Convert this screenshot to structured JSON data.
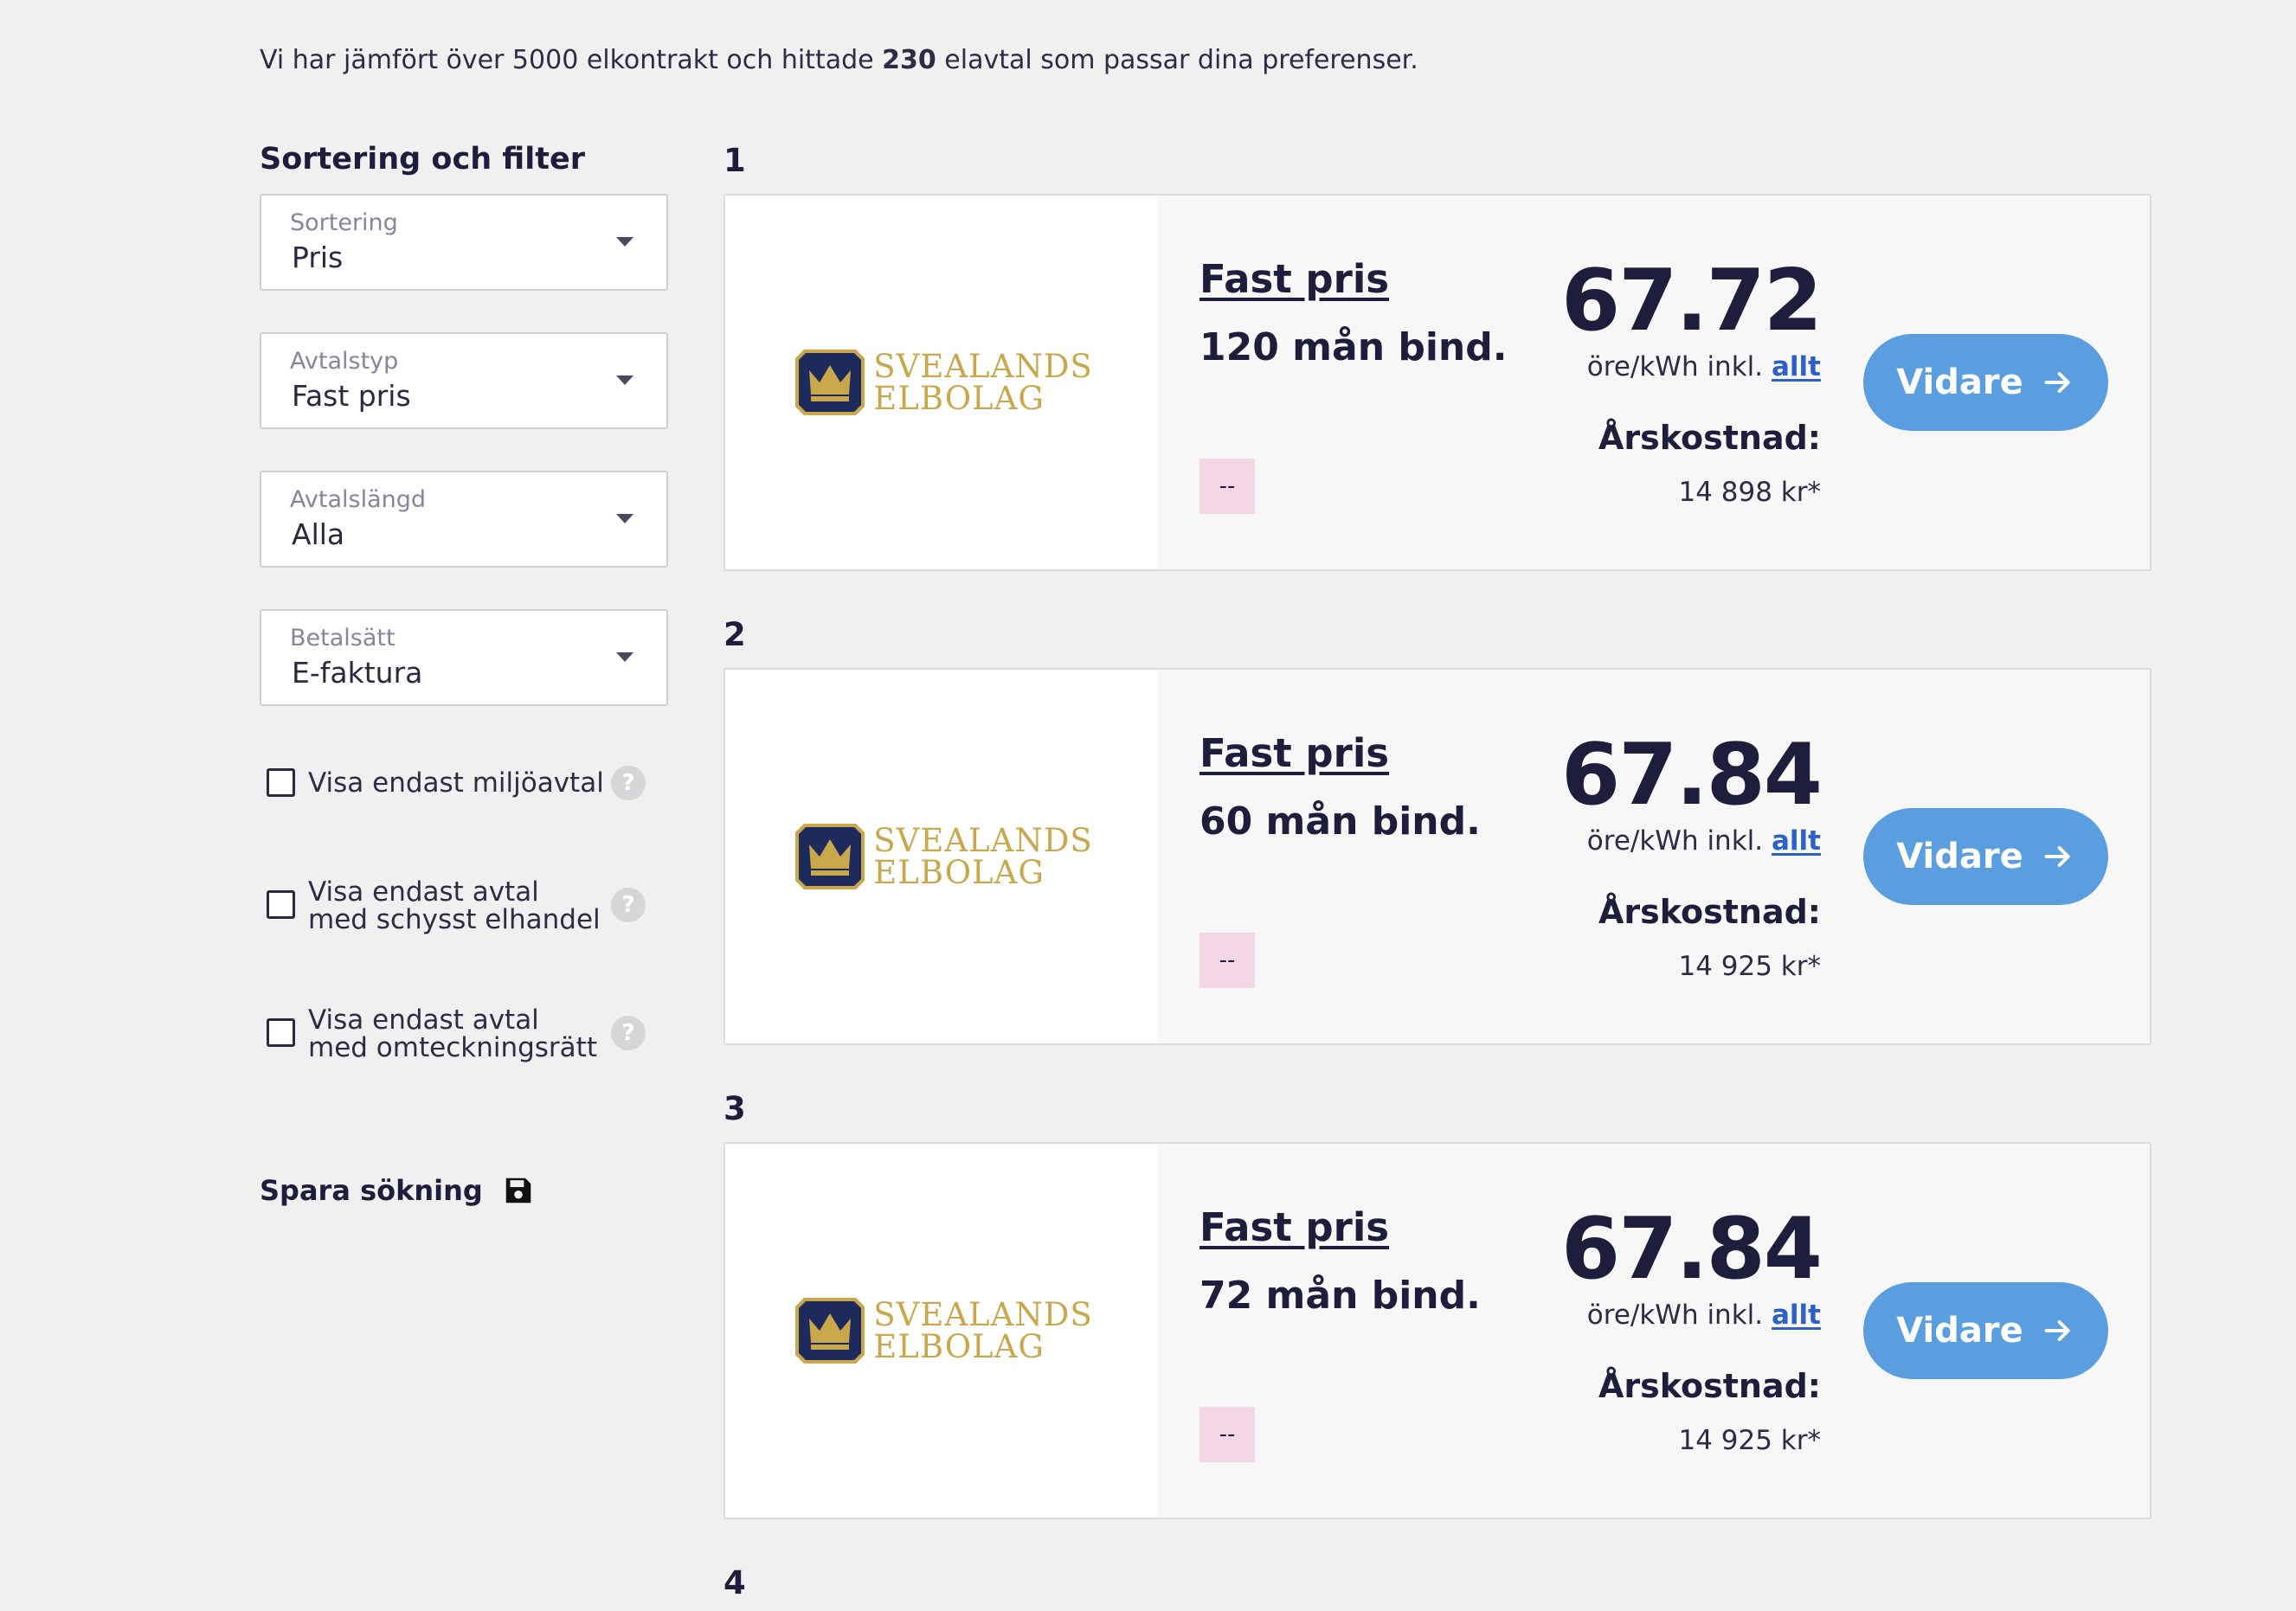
{
  "summary": {
    "prefix": "Vi har jämfört över 5000 elkontrakt och hittade ",
    "count": "230",
    "suffix": " elavtal som passar dina preferenser."
  },
  "sidebar": {
    "title": "Sortering och filter",
    "selects": [
      {
        "label": "Sortering",
        "value": "Pris"
      },
      {
        "label": "Avtalstyp",
        "value": "Fast pris"
      },
      {
        "label": "Avtalslängd",
        "value": "Alla"
      },
      {
        "label": "Betalsätt",
        "value": "E-faktura"
      }
    ],
    "checkboxes": [
      {
        "line1": "Visa endast miljöavtal",
        "line2": ""
      },
      {
        "line1": "Visa endast avtal",
        "line2": "med schysst elhandel"
      },
      {
        "line1": "Visa endast avtal",
        "line2": "med omteckningsrätt"
      }
    ],
    "help_glyph": "?",
    "save_search": "Spara sökning"
  },
  "results": [
    {
      "rank": "1",
      "provider_line1": "SVEALANDS",
      "provider_line2": "ELBOLAG",
      "type": "Fast pris",
      "binding": "120 mån bind.",
      "tag": "--",
      "price": "67.72",
      "unit": "öre/kWh inkl.",
      "unit_link": "allt",
      "yearly_label": "Årskostnad:",
      "yearly_value": "14 898 kr*",
      "button": "Vidare"
    },
    {
      "rank": "2",
      "provider_line1": "SVEALANDS",
      "provider_line2": "ELBOLAG",
      "type": "Fast pris",
      "binding": "60 mån bind.",
      "tag": "--",
      "price": "67.84",
      "unit": "öre/kWh inkl.",
      "unit_link": "allt",
      "yearly_label": "Årskostnad:",
      "yearly_value": "14 925 kr*",
      "button": "Vidare"
    },
    {
      "rank": "3",
      "provider_line1": "SVEALANDS",
      "provider_line2": "ELBOLAG",
      "type": "Fast pris",
      "binding": "72 mån bind.",
      "tag": "--",
      "price": "67.84",
      "unit": "öre/kWh inkl.",
      "unit_link": "allt",
      "yearly_label": "Årskostnad:",
      "yearly_value": "14 925 kr*",
      "button": "Vidare"
    }
  ],
  "next_rank": "4",
  "colors": {
    "background": "#f0f0f0",
    "text_dark": "#1e1d3c",
    "button": "#5a9ee0",
    "link": "#2c61c8",
    "tag": "#f4d7e5",
    "logo_gold": "#c8a84b",
    "logo_navy": "#1f2a5c"
  },
  "icons": {
    "save": "floppy-disk-icon",
    "dropdown": "caret-down-icon",
    "button_arrow": "arrow-right-icon",
    "help": "question-mark-icon",
    "logo": "crown-badge-icon"
  }
}
